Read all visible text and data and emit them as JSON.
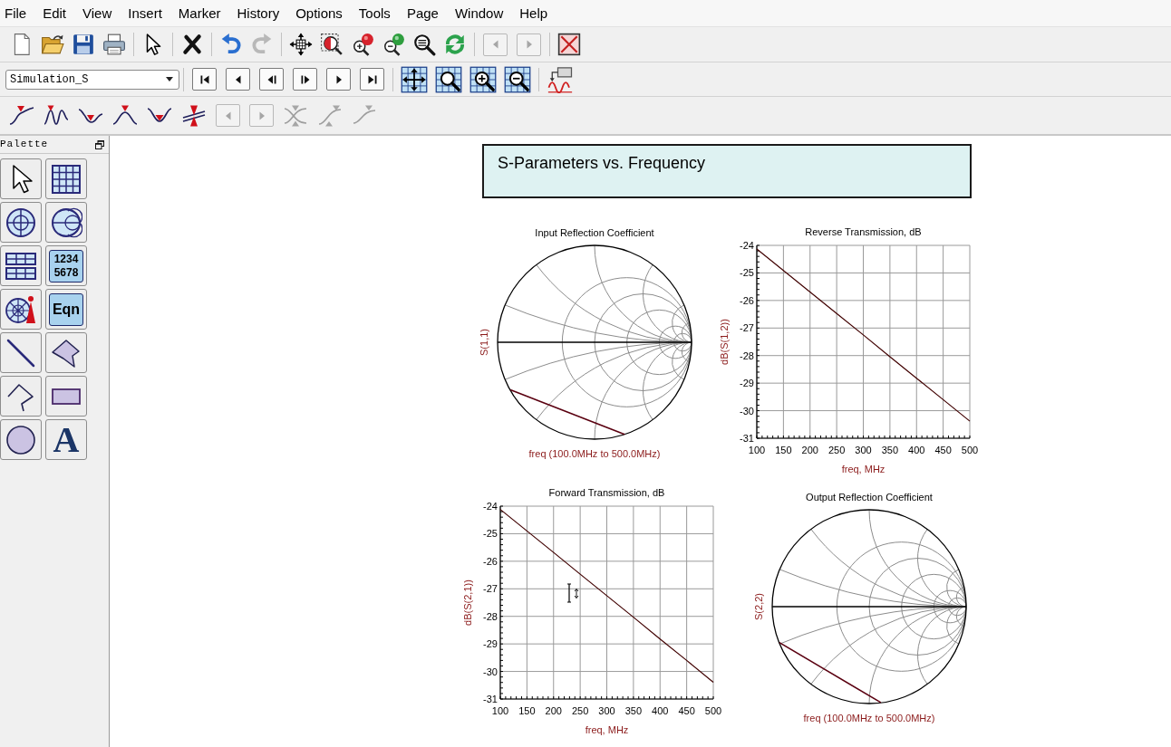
{
  "menu_bar": {
    "items": [
      "File",
      "Edit",
      "View",
      "Insert",
      "Marker",
      "History",
      "Options",
      "Tools",
      "Page",
      "Window",
      "Help"
    ]
  },
  "main_toolbar": {
    "groups": [
      [
        {
          "kind": "new",
          "disabled": false
        },
        {
          "kind": "open",
          "disabled": false
        },
        {
          "kind": "save",
          "disabled": false
        },
        {
          "kind": "print",
          "disabled": false
        }
      ],
      [
        {
          "kind": "select",
          "disabled": false
        }
      ],
      [
        {
          "kind": "delete",
          "disabled": false
        }
      ],
      [
        {
          "kind": "undo",
          "disabled": false
        },
        {
          "kind": "redo",
          "disabled": true
        }
      ],
      [
        {
          "kind": "move",
          "disabled": false
        },
        {
          "kind": "zoom_box",
          "disabled": false
        },
        {
          "kind": "zoom_in",
          "disabled": false
        },
        {
          "kind": "zoom_out",
          "disabled": false
        },
        {
          "kind": "zoom_fit",
          "disabled": false
        },
        {
          "kind": "refresh",
          "disabled": false
        }
      ],
      [
        {
          "kind": "prev",
          "disabled": true
        },
        {
          "kind": "next",
          "disabled": true
        }
      ],
      [
        {
          "kind": "close_box",
          "disabled": false
        }
      ]
    ]
  },
  "display_toolbar": {
    "dataset": {
      "value": "Simulation_S"
    },
    "groups": [
      [
        {
          "kind": "first",
          "disabled": false
        },
        {
          "kind": "prev",
          "disabled": false
        },
        {
          "kind": "step_back",
          "disabled": false
        },
        {
          "kind": "step_forward",
          "disabled": false
        },
        {
          "kind": "next",
          "disabled": false
        },
        {
          "kind": "last",
          "disabled": false
        }
      ],
      [
        {
          "kind": "grid_fit",
          "disabled": false
        },
        {
          "kind": "grid_zoom_box",
          "disabled": false
        },
        {
          "kind": "grid_zoom_in",
          "disabled": false
        },
        {
          "kind": "grid_zoom_out",
          "disabled": false
        }
      ],
      [
        {
          "kind": "waveform",
          "disabled": false
        }
      ]
    ]
  },
  "marker_toolbar": {
    "groups": [
      [
        {
          "kind": "marker_rise",
          "disabled": false
        },
        {
          "kind": "marker_wave",
          "disabled": false
        },
        {
          "kind": "marker_fall",
          "disabled": false
        },
        {
          "kind": "marker_peak",
          "disabled": false
        },
        {
          "kind": "marker_valley",
          "disabled": false
        },
        {
          "kind": "marker_lines",
          "disabled": false
        },
        {
          "kind": "prev",
          "disabled": true
        },
        {
          "kind": "next",
          "disabled": true
        },
        {
          "kind": "marker_cross",
          "disabled": true
        },
        {
          "kind": "marker_double",
          "disabled": true
        },
        {
          "kind": "marker_single",
          "disabled": true
        }
      ]
    ]
  },
  "palette": {
    "title": "Palette",
    "items": [
      {
        "kind": "pointer"
      },
      {
        "kind": "rect_plot"
      },
      {
        "kind": "polar"
      },
      {
        "kind": "smith"
      },
      {
        "kind": "list"
      },
      {
        "kind": "stack",
        "lines": [
          "1234",
          "5678"
        ]
      },
      {
        "kind": "antenna"
      },
      {
        "kind": "equation",
        "label": "Eqn"
      },
      {
        "kind": "line"
      },
      {
        "kind": "polygon"
      },
      {
        "kind": "polyline"
      },
      {
        "kind": "rectangle"
      },
      {
        "kind": "circle"
      },
      {
        "kind": "text",
        "label": "A"
      }
    ]
  },
  "page": {
    "title": "S-Parameters vs. Frequency",
    "plots": [
      {
        "kind": "smith",
        "title": "Input Reflection Coefficient",
        "ylabel": "S(1,1)",
        "range_label": "freq (100.0MHz to 500.0MHz)"
      },
      {
        "kind": "rectangular",
        "chart_data": {
          "type": "line",
          "title": "Reverse Transmission, dB",
          "xlabel": "freq, MHz",
          "ylabel": "dB(S(1,2))",
          "x": [
            100,
            150,
            200,
            250,
            300,
            350,
            400,
            450,
            500
          ],
          "series": [
            {
              "color": "#400000",
              "values": [
                -24.13,
                -24.91,
                -25.69,
                -26.47,
                -27.25,
                -28.04,
                -28.82,
                -29.6,
                -30.38
              ]
            }
          ],
          "xlim": [
            100,
            500
          ],
          "ylim": [
            -31,
            -24
          ],
          "xticks": [
            100,
            150,
            200,
            250,
            300,
            350,
            400,
            450,
            500
          ],
          "yticks": [
            -31,
            -30,
            -29,
            -28,
            -27,
            -26,
            -25,
            -24
          ],
          "grid": true
        }
      },
      {
        "kind": "rectangular",
        "chart_data": {
          "type": "line",
          "title": "Forward Transmission, dB",
          "xlabel": "freq, MHz",
          "ylabel": "dB(S(2,1))",
          "x": [
            100,
            150,
            200,
            250,
            300,
            350,
            400,
            450,
            500
          ],
          "series": [
            {
              "color": "#400000",
              "values": [
                -24.12,
                -24.9,
                -25.68,
                -26.47,
                -27.25,
                -28.03,
                -28.82,
                -29.6,
                -30.39
              ]
            }
          ],
          "xlim": [
            100,
            500
          ],
          "ylim": [
            -31,
            -24
          ],
          "xticks": [
            100,
            150,
            200,
            250,
            300,
            350,
            400,
            450,
            500
          ],
          "yticks": [
            -31,
            -30,
            -29,
            -28,
            -27,
            -26,
            -25,
            -24
          ],
          "grid": true
        }
      },
      {
        "kind": "smith",
        "title": "Output Reflection Coefficient",
        "ylabel": "S(2,2)",
        "range_label": "freq (100.0MHz to 500.0MHz)"
      }
    ],
    "mouse_pointer": {
      "kind": "i_beam"
    }
  }
}
